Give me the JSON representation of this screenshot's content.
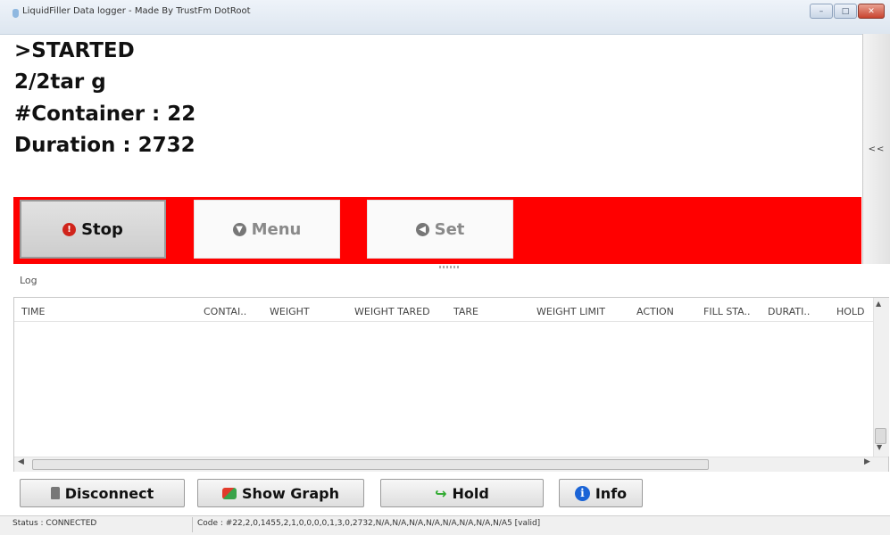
{
  "window": {
    "title": "LiquidFiller Data logger - Made By TrustFm DotRoot",
    "controls": {
      "minimize": "–",
      "maximize": "□",
      "close": "✕"
    }
  },
  "main": {
    "lines": [
      ">STARTED",
      "2/2tar g",
      "#Container : 22",
      "Duration : 2732"
    ],
    "side_toggle": "<<"
  },
  "toolbar": {
    "stop_label": "Stop",
    "menu_label": "Menu",
    "set_label": "Set"
  },
  "log": {
    "label": "Log",
    "columns": [
      "TIME",
      "CONTAI..",
      "WEIGHT",
      "WEIGHT TARED",
      "TARE",
      "WEIGHT LIMIT",
      "ACTION",
      "FILL STA..",
      "DURATI..",
      "HOLD"
    ],
    "rows": []
  },
  "bottom": {
    "disconnect_label": "Disconnect",
    "graph_label": "Show Graph",
    "hold_label": "Hold",
    "info_label": "Info"
  },
  "status": {
    "status_text": "Status : CONNECTED",
    "code_text": "Code : #22,2,0,1455,2,1,0,0,0,0,1,3,0,2732,N/A,N/A,N/A,N/A,N/A,N/A,N/A,N/A5 [valid]"
  },
  "colors": {
    "accent_bar": "#ff0000",
    "stop_icon": "#d0241b",
    "info_icon": "#1b64d6"
  },
  "icons": [
    "power-stop-icon",
    "menu-arrow-icon",
    "set-arrow-icon",
    "plug-icon",
    "graph-icon",
    "hold-arrow-icon",
    "info-icon"
  ]
}
